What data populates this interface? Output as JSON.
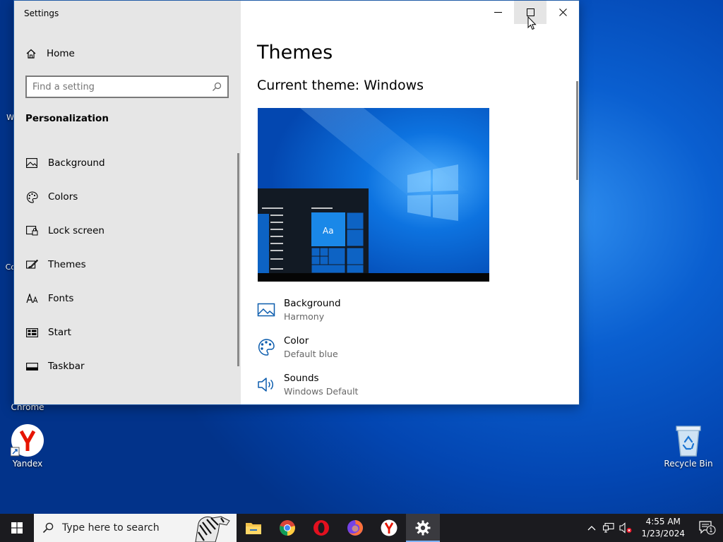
{
  "window": {
    "app_title": "Settings",
    "home_label": "Home",
    "search_placeholder": "Find a setting",
    "section": "Personalization",
    "nav": [
      {
        "label": "Background",
        "icon": "image-icon"
      },
      {
        "label": "Colors",
        "icon": "palette-icon"
      },
      {
        "label": "Lock screen",
        "icon": "lock-screen-icon"
      },
      {
        "label": "Themes",
        "icon": "brush-icon"
      },
      {
        "label": "Fonts",
        "icon": "font-icon"
      },
      {
        "label": "Start",
        "icon": "start-icon"
      },
      {
        "label": "Taskbar",
        "icon": "taskbar-icon"
      }
    ]
  },
  "content": {
    "title": "Themes",
    "current_theme": "Current theme: Windows",
    "preview_tile_text": "Aa",
    "options": [
      {
        "title": "Background",
        "value": "Harmony",
        "icon": "image-icon"
      },
      {
        "title": "Color",
        "value": "Default blue",
        "icon": "palette-icon"
      },
      {
        "title": "Sounds",
        "value": "Windows Default",
        "icon": "speaker-icon"
      }
    ]
  },
  "desktop": {
    "icons": [
      {
        "label": "Chrome"
      },
      {
        "label": "Yandex"
      },
      {
        "label": "Recycle Bin"
      }
    ],
    "partial_labels": [
      "W",
      "Co"
    ]
  },
  "taskbar": {
    "search_placeholder": "Type here to search",
    "time": "4:55 AM",
    "date": "1/23/2024",
    "notification_count": "1"
  },
  "colors": {
    "accent": "#0078d7",
    "taskbar": "#1b1b1f"
  }
}
